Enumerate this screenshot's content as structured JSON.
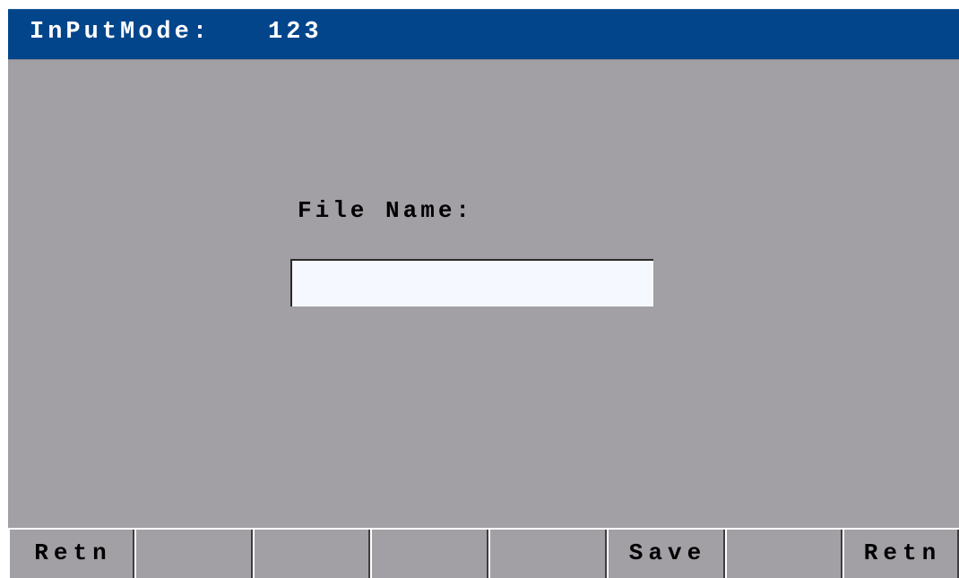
{
  "header": {
    "input_mode_label": "InPutMode:",
    "input_mode_value": "123"
  },
  "form": {
    "file_name_label": "File Name:",
    "file_name_value": ""
  },
  "softkeys": [
    {
      "label": "Retn"
    },
    {
      "label": ""
    },
    {
      "label": ""
    },
    {
      "label": ""
    },
    {
      "label": ""
    },
    {
      "label": "Save"
    },
    {
      "label": ""
    },
    {
      "label": "Retn"
    }
  ],
  "colors": {
    "title_bar": "#02458b",
    "panel_background": "#a29fa5",
    "input_background": "#f6f8ff"
  }
}
